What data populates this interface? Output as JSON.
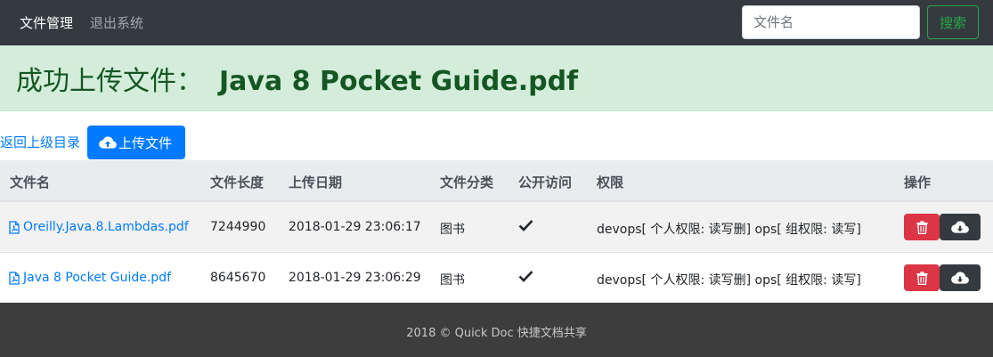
{
  "navbar": {
    "brand": "文件管理",
    "logout": "退出系统",
    "search_placeholder": "文件名",
    "search_button": "搜索"
  },
  "alert": {
    "prefix": "成功上传文件：",
    "filename": "Java 8 Pocket Guide.pdf"
  },
  "toolbar": {
    "back": "返回上级目录",
    "upload": "上传文件"
  },
  "table": {
    "headers": {
      "name": "文件名",
      "size": "文件长度",
      "date": "上传日期",
      "category": "文件分类",
      "public": "公开访问",
      "permission": "权限",
      "actions": "操作"
    },
    "rows": [
      {
        "name": "Oreilly.Java.8.Lambdas.pdf",
        "size": "7244990",
        "date": "2018-01-29 23:06:17",
        "category": "图书",
        "public": "✔",
        "permission": "devops[ 个人权限: 读写删] ops[ 组权限: 读写]"
      },
      {
        "name": "Java 8 Pocket Guide.pdf",
        "size": "8645670",
        "date": "2018-01-29 23:06:29",
        "category": "图书",
        "public": "✔",
        "permission": "devops[ 个人权限: 读写删] ops[ 组权限: 读写]"
      }
    ]
  },
  "footer": {
    "text": "2018 © Quick Doc 快捷文档共享"
  },
  "colors": {
    "navbar": "#343a40",
    "success_bg": "#d4edda",
    "success_text": "#155724",
    "primary": "#007bff",
    "danger": "#dc3545",
    "green_outline": "#28a745",
    "footer": "#3d3d3d"
  },
  "icons": {
    "upload": "cloud-upload-icon",
    "file": "file-pdf-icon",
    "check": "check-icon",
    "delete": "trash-icon",
    "download": "cloud-download-icon"
  }
}
